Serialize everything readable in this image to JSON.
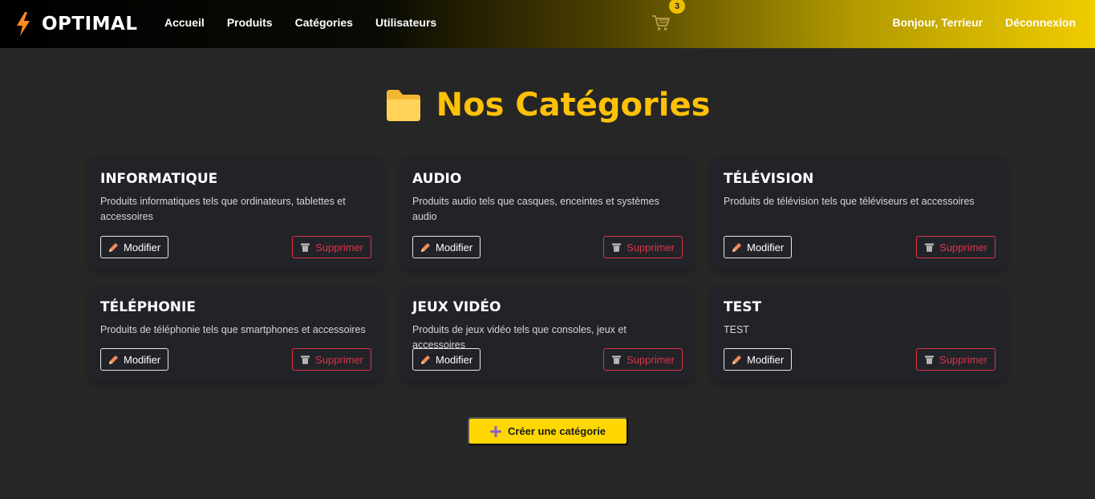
{
  "navbar": {
    "brand_name": "OPTIMAL",
    "links": [
      "Accueil",
      "Produits",
      "Catégories",
      "Utilisateurs"
    ],
    "cart_count": "3",
    "greeting": "Bonjour, Terrieur",
    "logout_label": "Déconnexion"
  },
  "header": {
    "title": "Nos Catégories"
  },
  "categories": [
    {
      "title": "INFORMATIQUE",
      "description": "Produits informatiques tels que ordinateurs, tablettes et accessoires",
      "edit_label": "Modifier",
      "delete_label": "Supprimer"
    },
    {
      "title": "AUDIO",
      "description": "Produits audio tels que casques, enceintes et systèmes audio",
      "edit_label": "Modifier",
      "delete_label": "Supprimer"
    },
    {
      "title": "TÉLÉVISION",
      "description": "Produits de télévision tels que téléviseurs et accessoires",
      "edit_label": "Modifier",
      "delete_label": "Supprimer"
    },
    {
      "title": "TÉLÉPHONIE",
      "description": "Produits de téléphonie tels que smartphones et accessoires",
      "edit_label": "Modifier",
      "delete_label": "Supprimer"
    },
    {
      "title": "JEUX VIDÉO",
      "description": "Produits de jeux vidéo tels que consoles, jeux et accessoires",
      "edit_label": "Modifier",
      "delete_label": "Supprimer"
    },
    {
      "title": "TEST",
      "description": "TEST",
      "edit_label": "Modifier",
      "delete_label": "Supprimer"
    }
  ],
  "create_button": {
    "label": "Créer une catégorie"
  },
  "icons": {
    "brand": "lightning-icon",
    "cart": "cart-icon",
    "header": "folder-icon",
    "edit": "pencil-icon",
    "delete": "trash-icon",
    "create": "plus-icon"
  },
  "colors": {
    "accent_yellow": "#ffc107",
    "button_yellow": "#ffd700",
    "danger_red": "#dc3545",
    "card_bg": "#212329",
    "page_bg": "#262626"
  }
}
